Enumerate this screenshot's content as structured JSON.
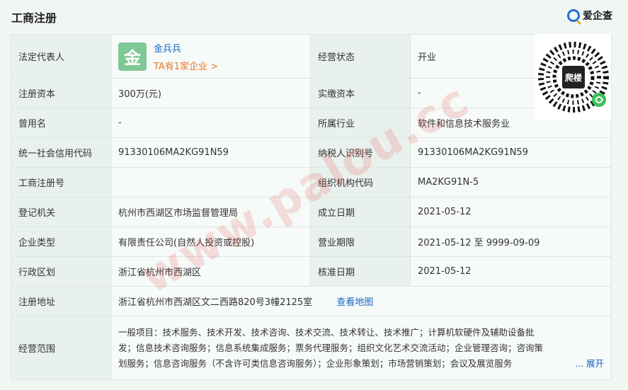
{
  "header": {
    "title": "工商注册",
    "brand": "爱企查"
  },
  "rows": {
    "legal_rep": {
      "label": "法定代表人",
      "avatar_char": "金",
      "name": "金兵兵",
      "link": "TA有1家企业 >"
    },
    "op_status": {
      "label": "经营状态",
      "value": "开业"
    },
    "reg_capital": {
      "label": "注册资本",
      "value": "300万(元)"
    },
    "paid_capital": {
      "label": "实缴资本",
      "value": "-"
    },
    "former_name": {
      "label": "曾用名",
      "value": "-"
    },
    "industry": {
      "label": "所属行业",
      "value": "软件和信息技术服务业"
    },
    "credit_code": {
      "label": "统一社会信用代码",
      "value": "91330106MA2KG91N59"
    },
    "taxpayer_id": {
      "label": "纳税人识别号",
      "value": "91330106MA2KG91N59"
    },
    "reg_no": {
      "label": "工商注册号",
      "value": ""
    },
    "org_code": {
      "label": "组织机构代码",
      "value": "MA2KG91N-5"
    },
    "authority": {
      "label": "登记机关",
      "value": "杭州市西湖区市场监督管理局"
    },
    "founded": {
      "label": "成立日期",
      "value": "2021-05-12"
    },
    "company_type": {
      "label": "企业类型",
      "value": "有限责任公司(自然人投资或控股)"
    },
    "term": {
      "label": "营业期限",
      "value": "2021-05-12 至 9999-09-09"
    },
    "district": {
      "label": "行政区划",
      "value": "浙江省杭州市西湖区"
    },
    "approval_date": {
      "label": "核准日期",
      "value": "2021-05-12"
    },
    "address": {
      "label": "注册地址",
      "value": "浙江省杭州市西湖区文二西路820号3幢2125室",
      "map_link": "查看地图"
    },
    "scope": {
      "label": "经营范围",
      "line1": "一般项目：技术服务、技术开发、技术咨询、技术交流、技术转让、技术推广；计算机软硬件及辅助设备批",
      "line2": "发；信息技术咨询服务；信息系统集成服务；票务代理服务；组织文化艺术交流活动；企业管理咨询；咨询策",
      "line3": "划服务；信息咨询服务（不含许可类信息咨询服务）；企业形象策划；市场营销策划；会议及展览服务",
      "expand": "... 展开"
    }
  },
  "qr": {
    "badge_text": "爬楼"
  },
  "watermark": "www.palou.cc",
  "colors": {
    "label_bg": "#e9f1ec",
    "link_blue": "#1a64c8",
    "link_orange": "#e8782a",
    "avatar_green": "#7ec896"
  }
}
